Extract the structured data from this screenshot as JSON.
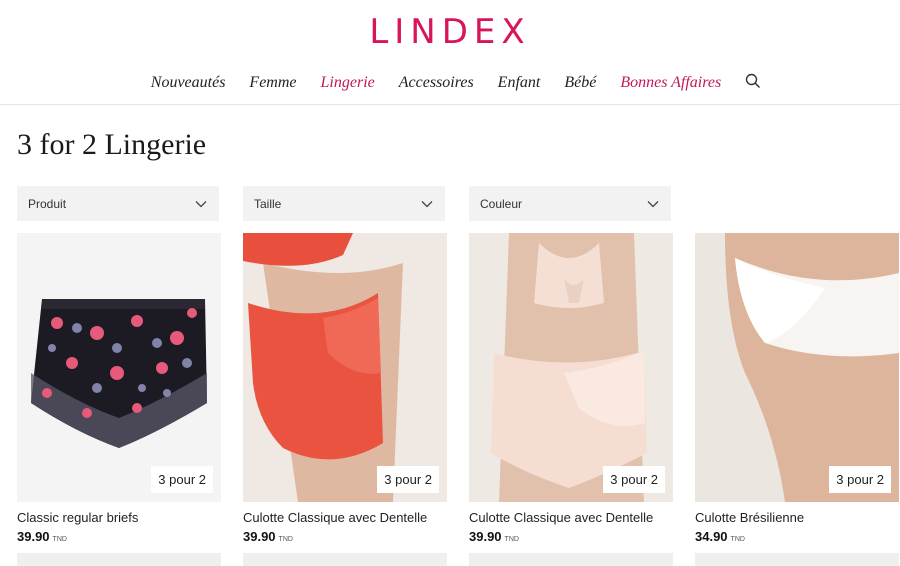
{
  "brand": {
    "logo": "LINDEX",
    "accent": "#d8145d"
  },
  "nav": {
    "items": [
      {
        "label": "Nouveautés",
        "state": "normal"
      },
      {
        "label": "Femme",
        "state": "normal"
      },
      {
        "label": "Lingerie",
        "state": "active"
      },
      {
        "label": "Accessoires",
        "state": "normal"
      },
      {
        "label": "Enfant",
        "state": "normal"
      },
      {
        "label": "Bébé",
        "state": "normal"
      },
      {
        "label": "Bonnes Affaires",
        "state": "sale"
      }
    ],
    "search_icon": "search-icon"
  },
  "page": {
    "title": "3 for 2 Lingerie"
  },
  "filters": [
    {
      "label": "Produit"
    },
    {
      "label": "Taille"
    },
    {
      "label": "Couleur"
    }
  ],
  "products": [
    {
      "name": "Classic regular briefs",
      "price": "39.90",
      "currency": "TND",
      "badge": "3 pour 2"
    },
    {
      "name": "Culotte Classique avec Dentelle",
      "price": "39.90",
      "currency": "TND",
      "badge": "3 pour 2"
    },
    {
      "name": "Culotte Classique avec Dentelle",
      "price": "39.90",
      "currency": "TND",
      "badge": "3 pour 2"
    },
    {
      "name": "Culotte Brésilienne",
      "price": "34.90",
      "currency": "TND",
      "badge": "3 pour 2"
    }
  ]
}
